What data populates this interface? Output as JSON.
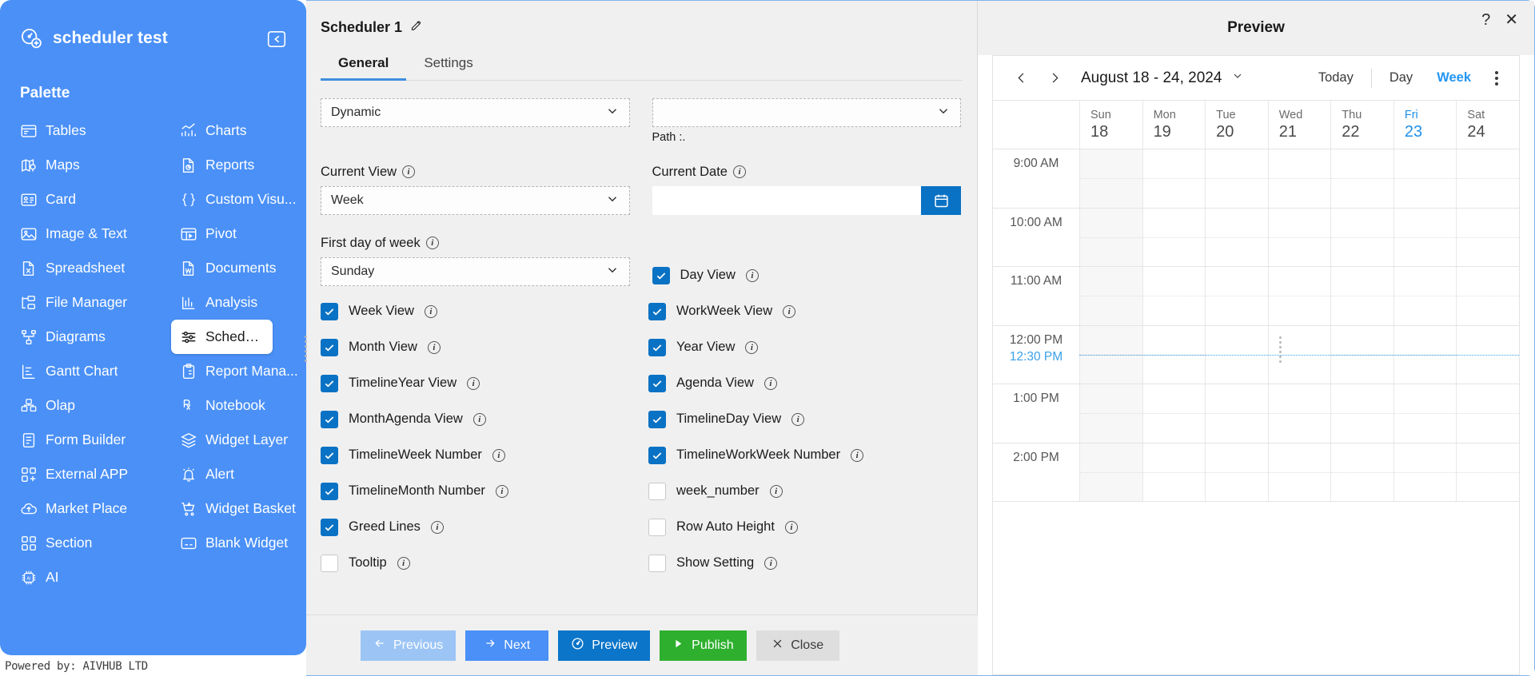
{
  "sidebar": {
    "title": "scheduler test",
    "logo_icon": "dashboard-add-icon",
    "collapse_icon": "collapse-panel-icon",
    "palette_label": "Palette",
    "items": [
      {
        "label": "Tables",
        "icon": "table-icon"
      },
      {
        "label": "Charts",
        "icon": "bar-chart-icon"
      },
      {
        "label": "Maps",
        "icon": "map-pin-icon"
      },
      {
        "label": "Reports",
        "icon": "report-doc-icon"
      },
      {
        "label": "Card",
        "icon": "id-card-icon"
      },
      {
        "label": "Custom Visu...",
        "icon": "braces-icon"
      },
      {
        "label": "Image & Text",
        "icon": "image-icon"
      },
      {
        "label": "Pivot",
        "icon": "pivot-table-icon"
      },
      {
        "label": "Spreadsheet",
        "icon": "excel-file-icon"
      },
      {
        "label": "Documents",
        "icon": "word-file-icon"
      },
      {
        "label": "File Manager",
        "icon": "folder-tree-icon"
      },
      {
        "label": "Analysis",
        "icon": "analysis-chart-icon"
      },
      {
        "label": "Diagrams",
        "icon": "node-graph-icon"
      },
      {
        "label": "Scheduler",
        "icon": "sliders-icon"
      },
      {
        "label": "Gantt Chart",
        "icon": "gantt-icon"
      },
      {
        "label": "Report Mana...",
        "icon": "clipboard-icon"
      },
      {
        "label": "Olap",
        "icon": "cubes-icon"
      },
      {
        "label": "Notebook",
        "icon": "rx-notebook-icon"
      },
      {
        "label": "Form Builder",
        "icon": "form-doc-icon"
      },
      {
        "label": "Widget Layer",
        "icon": "layers-icon"
      },
      {
        "label": "External APP",
        "icon": "app-add-icon"
      },
      {
        "label": "Alert",
        "icon": "bell-alert-icon"
      },
      {
        "label": "Market Place",
        "icon": "cloud-upload-icon"
      },
      {
        "label": "Widget Basket",
        "icon": "cart-icon"
      },
      {
        "label": "Section",
        "icon": "grid-sections-icon"
      },
      {
        "label": "Blank Widget",
        "icon": "blank-widget-icon"
      },
      {
        "label": "AI",
        "icon": "ai-chip-icon"
      }
    ],
    "active_item": "Scheduler",
    "footer": "Powered by: AIVHUB LTD"
  },
  "window": {
    "help_icon": "?",
    "close_icon": "✕"
  },
  "panel": {
    "title": "Scheduler 1",
    "edit_icon": "pencil-edit-icon",
    "tabs": [
      {
        "label": "General",
        "selected": true
      },
      {
        "label": "Settings",
        "selected": false
      }
    ]
  },
  "form": {
    "datasource_value": "Dynamic",
    "datasource_placeholder": "",
    "path_value": "",
    "path_placeholder": "",
    "path_note": "Path :.",
    "current_view_label": "Current View",
    "current_view_value": "Week",
    "current_date_label": "Current Date",
    "current_date_value": "",
    "current_date_placeholder": "",
    "calendar_button_icon": "calendar-icon",
    "first_day_label": "First day of week",
    "first_day_value": "Sunday",
    "checkboxes_left": [
      {
        "label": "Week View",
        "checked": true
      },
      {
        "label": "Month View",
        "checked": true
      },
      {
        "label": "TimelineYear View",
        "checked": true
      },
      {
        "label": "MonthAgenda View",
        "checked": true
      },
      {
        "label": "TimelineWeek Number",
        "checked": true
      },
      {
        "label": "TimelineMonth Number",
        "checked": true
      },
      {
        "label": "Greed Lines",
        "checked": true
      },
      {
        "label": "Tooltip",
        "checked": false
      }
    ],
    "checkboxes_right": [
      {
        "label": "Day View",
        "checked": true
      },
      {
        "label": "WorkWeek View",
        "checked": true
      },
      {
        "label": "Year View",
        "checked": true
      },
      {
        "label": "Agenda View",
        "checked": true
      },
      {
        "label": "TimelineDay View",
        "checked": true
      },
      {
        "label": "TimelineWorkWeek Number",
        "checked": true
      },
      {
        "label": "week_number",
        "checked": false
      },
      {
        "label": "Row Auto Height",
        "checked": false
      },
      {
        "label": "Show Setting",
        "checked": false
      }
    ]
  },
  "actions": [
    {
      "label": "Previous",
      "icon": "arrow-left-icon",
      "style": "prev"
    },
    {
      "label": "Next",
      "icon": "arrow-right-icon",
      "style": "next"
    },
    {
      "label": "Preview",
      "icon": "eye-target-icon",
      "style": "preview"
    },
    {
      "label": "Publish",
      "icon": "play-icon",
      "style": "publish"
    },
    {
      "label": "Close",
      "icon": "x-icon",
      "style": "close"
    }
  ],
  "preview": {
    "title": "Preview",
    "toolbar": {
      "prev_icon": "chevron-left-icon",
      "next_icon": "chevron-right-icon",
      "date_range": "August 18 - 24, 2024",
      "date_dropdown_icon": "chevron-down-icon",
      "today_label": "Today",
      "day_label": "Day",
      "week_label": "Week",
      "active_view": "Week",
      "more_icon": "kebab-menu-icon"
    },
    "days": [
      {
        "dow": "Sun",
        "num": "18",
        "today": false,
        "weekend": true
      },
      {
        "dow": "Mon",
        "num": "19",
        "today": false,
        "weekend": false
      },
      {
        "dow": "Tue",
        "num": "20",
        "today": false,
        "weekend": false
      },
      {
        "dow": "Wed",
        "num": "21",
        "today": false,
        "weekend": false
      },
      {
        "dow": "Thu",
        "num": "22",
        "today": false,
        "weekend": false
      },
      {
        "dow": "Fri",
        "num": "23",
        "today": true,
        "weekend": false
      },
      {
        "dow": "Sat",
        "num": "24",
        "today": false,
        "weekend": false
      }
    ],
    "time_slots": [
      "9:00 AM",
      "10:00 AM",
      "11:00 AM",
      "12:00 PM",
      "1:00 PM",
      "2:00 PM"
    ],
    "current_time": "12:30 PM",
    "current_time_slot_index": 3
  },
  "colors": {
    "sidebar_blue": "#4a90f7",
    "accent_blue": "#0a72c4",
    "publish_green": "#2eb02e",
    "today_blue": "#1e90e8",
    "tab_underline": "#3f8ede"
  }
}
